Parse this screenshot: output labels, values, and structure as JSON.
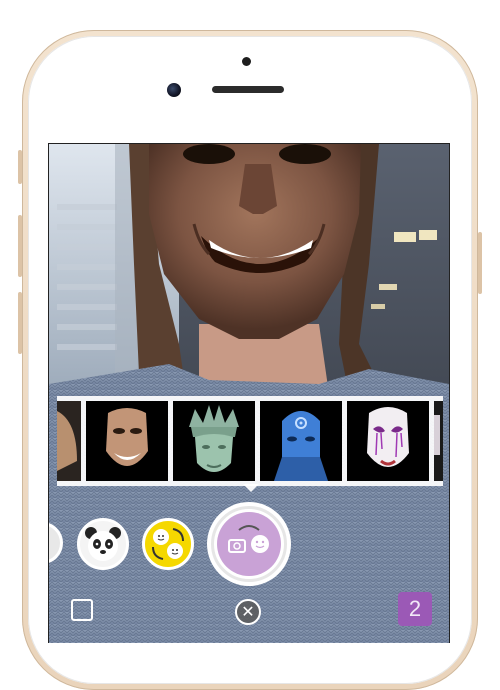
{
  "device": {
    "type": "iPhone",
    "color": "#ead4bb"
  },
  "filters": {
    "items": [
      {
        "name": "partial-mask",
        "icon": "purge-mask-icon"
      },
      {
        "name": "purge-mask",
        "icon": "purge-mask-icon"
      },
      {
        "name": "statue-of-liberty",
        "icon": "statue-of-liberty-icon"
      },
      {
        "name": "blue-face",
        "icon": "blue-face-icon"
      },
      {
        "name": "white-bleeding-mask",
        "icon": "white-mask-icon"
      }
    ]
  },
  "controls": {
    "mode_badge": "2",
    "close_symbol": "✕",
    "buttons": [
      {
        "name": "partial-lens",
        "icon": "lens-icon"
      },
      {
        "name": "panda-lens",
        "icon": "panda-icon"
      },
      {
        "name": "face-swap-lens",
        "icon": "face-swap-icon"
      },
      {
        "name": "capture",
        "icon": "capture-icon"
      }
    ]
  },
  "colors": {
    "accent": "#9b59b6",
    "capture_fill": "#c9a2d6",
    "face_swap": "#f5d800"
  }
}
